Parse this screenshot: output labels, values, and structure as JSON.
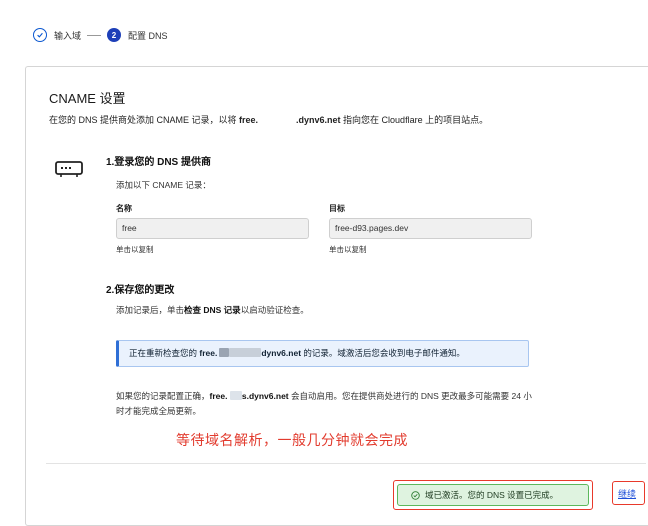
{
  "stepper": {
    "step1_label": "输入域",
    "step2_number": "2",
    "step2_label": "配置 DNS"
  },
  "card": {
    "title": "CNAME 设置",
    "subtitle_prefix": "在您的 DNS 提供商处添加 CNAME 记录，以将 ",
    "subtitle_domain_start": "free.",
    "subtitle_domain_end": ".dynv6.net",
    "subtitle_suffix": " 指向您在 Cloudflare 上的项目站点。"
  },
  "step1": {
    "title": "1.登录您的 DNS 提供商",
    "description": "添加以下 CNAME 记录：",
    "name_label": "名称",
    "name_value": "free",
    "name_hint": "单击以复制",
    "target_label": "目标",
    "target_value": "free-d93.pages.dev",
    "target_hint": "单击以复制"
  },
  "step2": {
    "title": "2.保存您的更改",
    "desc_prefix": "添加记录后，单击",
    "desc_bold": "检查 DNS 记录",
    "desc_suffix": "以启动验证检查。"
  },
  "info": {
    "prefix": "正在重新检查您的 ",
    "domain_start": "free.",
    "domain_end": "dynv6.net",
    "suffix": " 的记录。域激活后您会收到电子邮件通知。"
  },
  "note": {
    "prefix": "如果您的记录配置正确，",
    "domain_start": "free.",
    "domain_end": "s.dynv6.net",
    "suffix": " 会自动启用。您在提供商处进行的 DNS 更改最多可能需要 24 小时才能完成全局更新。"
  },
  "annotation": "等待域名解析，一般几分钟就会完成",
  "footer": {
    "status_text": "域已激活。您的 DNS 设置已完成。",
    "continue_label": "继续"
  },
  "colors": {
    "accent": "#1d3fb8",
    "success_bg": "#dff3e0",
    "success_border": "#5cb85c",
    "annotation_red": "#e23b2e",
    "info_bg": "#eaf2fd"
  }
}
